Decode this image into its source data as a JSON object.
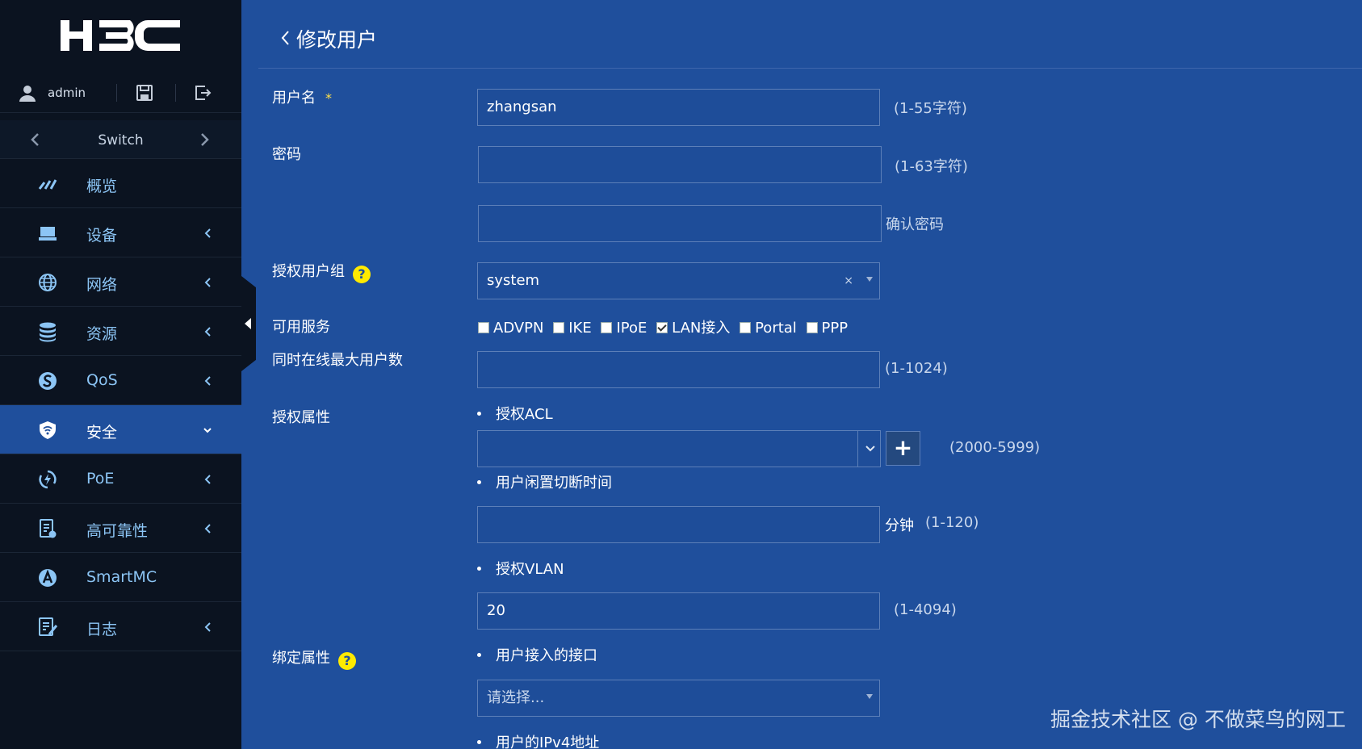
{
  "brand": {
    "logo_text": "H3C"
  },
  "user": {
    "name": "admin"
  },
  "switch_bar": {
    "label": "Switch"
  },
  "menu": [
    {
      "label": "概览",
      "icon": "gauge-icon",
      "has_arrow": false,
      "active": false
    },
    {
      "label": "设备",
      "icon": "device-icon",
      "has_arrow": true,
      "active": false
    },
    {
      "label": "网络",
      "icon": "globe-icon",
      "has_arrow": true,
      "active": false
    },
    {
      "label": "资源",
      "icon": "database-icon",
      "has_arrow": true,
      "active": false
    },
    {
      "label": "QoS",
      "icon": "qos-icon",
      "has_arrow": true,
      "active": false
    },
    {
      "label": "安全",
      "icon": "shield-icon",
      "has_arrow": true,
      "active": true
    },
    {
      "label": "PoE",
      "icon": "poe-icon",
      "has_arrow": true,
      "active": false
    },
    {
      "label": "高可靠性",
      "icon": "reliability-icon",
      "has_arrow": true,
      "active": false
    },
    {
      "label": "SmartMC",
      "icon": "smartmc-icon",
      "has_arrow": false,
      "active": false
    },
    {
      "label": "日志",
      "icon": "log-icon",
      "has_arrow": true,
      "active": false
    }
  ],
  "page": {
    "title": "修改用户"
  },
  "form": {
    "username": {
      "label": "用户名",
      "required_mark": "*",
      "value": "zhangsan",
      "hint": "(1-55字符)"
    },
    "password": {
      "label": "密码",
      "value": "",
      "hint": "(1-63字符)",
      "confirm_hint": "确认密码"
    },
    "user_group": {
      "label": "授权用户组",
      "help": "?",
      "value": "system",
      "clear": "×"
    },
    "services": {
      "label": "可用服务",
      "items": [
        {
          "label": "ADVPN",
          "checked": false
        },
        {
          "label": "IKE",
          "checked": false
        },
        {
          "label": "IPoE",
          "checked": false
        },
        {
          "label": "LAN接入",
          "checked": true
        },
        {
          "label": "Portal",
          "checked": false
        },
        {
          "label": "PPP",
          "checked": false
        }
      ]
    },
    "max_online": {
      "label": "同时在线最大用户数",
      "value": "",
      "hint": "(1-1024)"
    },
    "auth_attrs": {
      "label": "授权属性",
      "acl": {
        "label": "授权ACL",
        "value": "",
        "add": "+",
        "hint": "(2000-5999)"
      },
      "idle": {
        "label": "用户闲置切断时间",
        "value": "",
        "unit": "分钟",
        "hint": "(1-120)"
      },
      "vlan": {
        "label": "授权VLAN",
        "value": "20",
        "hint": "(1-4094)"
      }
    },
    "bind_attrs": {
      "label": "绑定属性",
      "help": "?",
      "interface": {
        "label": "用户接入的接口",
        "placeholder": "请选择..."
      },
      "ipv4": {
        "label": "用户的IPv4地址"
      }
    }
  },
  "watermark": "掘金技术社区 @ 不做菜鸟的网工",
  "colors": {
    "main_bg": "#1f4f9c",
    "sidebar_bg": "#0b1320",
    "accent_yellow": "#ffea00",
    "menu_text": "#8cc5f5"
  }
}
